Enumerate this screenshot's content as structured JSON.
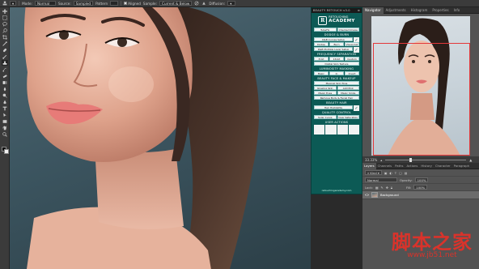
{
  "options_bar": {
    "mode_label": "Mode:",
    "mode_value": "Normal",
    "source_label": "Source:",
    "sampled_label": "Sampled",
    "pattern_label": "Pattern",
    "aligned_label": "Aligned",
    "sample_label": "Sample:",
    "sample_value": "Current & Below",
    "diffusion_label": "Diffusion:"
  },
  "toolbar": {
    "tools": [
      "move-tool-icon",
      "marquee-tool-icon",
      "lasso-tool-icon",
      "quick-select-tool-icon",
      "crop-tool-icon",
      "eyedropper-tool-icon",
      "healing-brush-tool-icon",
      "brush-tool-icon",
      "clone-stamp-tool-icon",
      "history-brush-tool-icon",
      "eraser-tool-icon",
      "gradient-tool-icon",
      "blur-tool-icon",
      "dodge-tool-icon",
      "pen-tool-icon",
      "type-tool-icon",
      "path-select-tool-icon",
      "rectangle-tool-icon",
      "hand-tool-icon",
      "zoom-tool-icon"
    ],
    "foreground_color": "#111111",
    "background_color": "#f0f0f0"
  },
  "beauty_panel": {
    "title": "BEAUTY RETOUCH v3.0",
    "logo_line1": "RETOUCHING",
    "logo_line2": "ACADEMY",
    "row_top": [
      "TubeFix",
      "Checked Image"
    ],
    "dodge_burn_head": "DODGE & BURN",
    "db_curves": "D&B Curves Setup",
    "db_buttons": [
      "Dodge",
      "Burn",
      "Visual Aid"
    ],
    "db_layers": "D&B Multiple Layer Setup",
    "freq_head": "FREQUENCY SEPARATION",
    "freq_buttons": [
      "8 bit",
      "16 bit",
      "Custom"
    ],
    "digital_skin": "Digital Skin Texture",
    "lum_head": "LUMINOSITY MASKING",
    "lum_buttons": [
      "Basic",
      "In",
      "Invert"
    ],
    "face_head": "BEAUTY FACE & MAKEUP",
    "magical_skin": "Magical Skin Tone",
    "face_row1": [
      "Glowing Skin",
      "Add Pink"
    ],
    "face_row2": [
      "Magic Eyes",
      "Magic Smile"
    ],
    "remove_body": "Remove Body & Facial Hair",
    "hair_head": "BEAUTY HAIR",
    "hair_highlights": "Hair Highlights",
    "quality_head": "QUALITY CONTROL",
    "quality_buttons": [
      "Solar Curve",
      "Over Saturation"
    ],
    "user_head": "USER ACTIONS",
    "footer": "retouchingacademy.com"
  },
  "navigator": {
    "tabs": [
      "Navigator",
      "Adjustments",
      "Histogram",
      "Properties",
      "Info"
    ],
    "zoom": "33.33%"
  },
  "layers": {
    "tabs": [
      "Layers",
      "Channels",
      "Paths",
      "Actions",
      "History",
      "Character",
      "Paragraph"
    ],
    "kind_label": "Kind",
    "blend_mode": "Normal",
    "opacity_label": "Opacity:",
    "opacity_value": "100%",
    "lock_label": "Lock:",
    "fill_label": "Fill:",
    "fill_value": "100%",
    "layer_name": "Background"
  },
  "watermark": {
    "cn": "脚本之家",
    "url": "www.jb51.net"
  }
}
